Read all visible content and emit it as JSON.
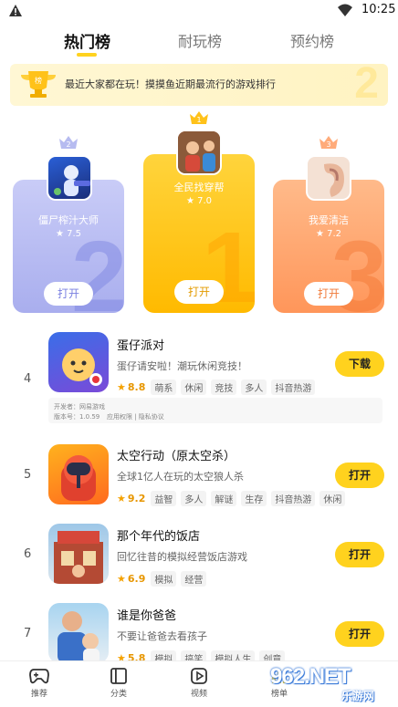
{
  "status_bar": {
    "time": "10:25"
  },
  "tabs": [
    {
      "label": "热门榜",
      "active": true
    },
    {
      "label": "耐玩榜",
      "active": false
    },
    {
      "label": "预约榜",
      "active": false
    }
  ],
  "banner": {
    "text": "最近大家都在玩！摸摸鱼近期最流行的游戏排行",
    "deco": "2"
  },
  "podium": [
    {
      "rank": "2",
      "name": "僵尸榨汁大师",
      "score": "7.5",
      "button": "打开",
      "color": "#b9bdf3"
    },
    {
      "rank": "1",
      "name": "全民找穿帮",
      "score": "7.0",
      "button": "打开",
      "color": "#ffc61a"
    },
    {
      "rank": "3",
      "name": "我爱清洁",
      "score": "7.2",
      "button": "打开",
      "color": "#ffa571"
    }
  ],
  "list": [
    {
      "rank": "4",
      "name": "蛋仔派对",
      "desc": "蛋仔请安啦！潮玩休闲竞技！",
      "score": "8.8",
      "tags": [
        "萌系",
        "休闲",
        "竞技",
        "多人",
        "抖音热游"
      ],
      "button": "下载",
      "dev": {
        "developer": "开发者：网易游戏",
        "version": "版本号：1.0.59",
        "links": "应用权限 | 隐私协议"
      }
    },
    {
      "rank": "5",
      "name": "太空行动（原太空杀）",
      "desc": "全球1亿人在玩的太空狼人杀",
      "score": "9.2",
      "tags": [
        "益智",
        "多人",
        "解谜",
        "生存",
        "抖音热游",
        "休闲"
      ],
      "button": "打开"
    },
    {
      "rank": "6",
      "name": "那个年代的饭店",
      "desc": "回忆往昔的模拟经营饭店游戏",
      "score": "6.9",
      "tags": [
        "模拟",
        "经营"
      ],
      "button": "打开"
    },
    {
      "rank": "7",
      "name": "谁是你爸爸",
      "desc": "不要让爸爸去看孩子",
      "score": "5.8",
      "tags": [
        "模拟",
        "搞笑",
        "模拟人生",
        "创意"
      ],
      "button": "打开"
    }
  ],
  "bottom_nav": [
    {
      "label": "推荐",
      "icon": "gamepad-icon"
    },
    {
      "label": "分类",
      "icon": "category-icon"
    },
    {
      "label": "视频",
      "icon": "video-icon"
    },
    {
      "label": "榜单",
      "icon": "rank-icon"
    }
  ],
  "watermark": {
    "main": "962.NET",
    "sub": "乐游网"
  },
  "colors": {
    "accent": "#ffd21e",
    "star": "#f5a200"
  }
}
